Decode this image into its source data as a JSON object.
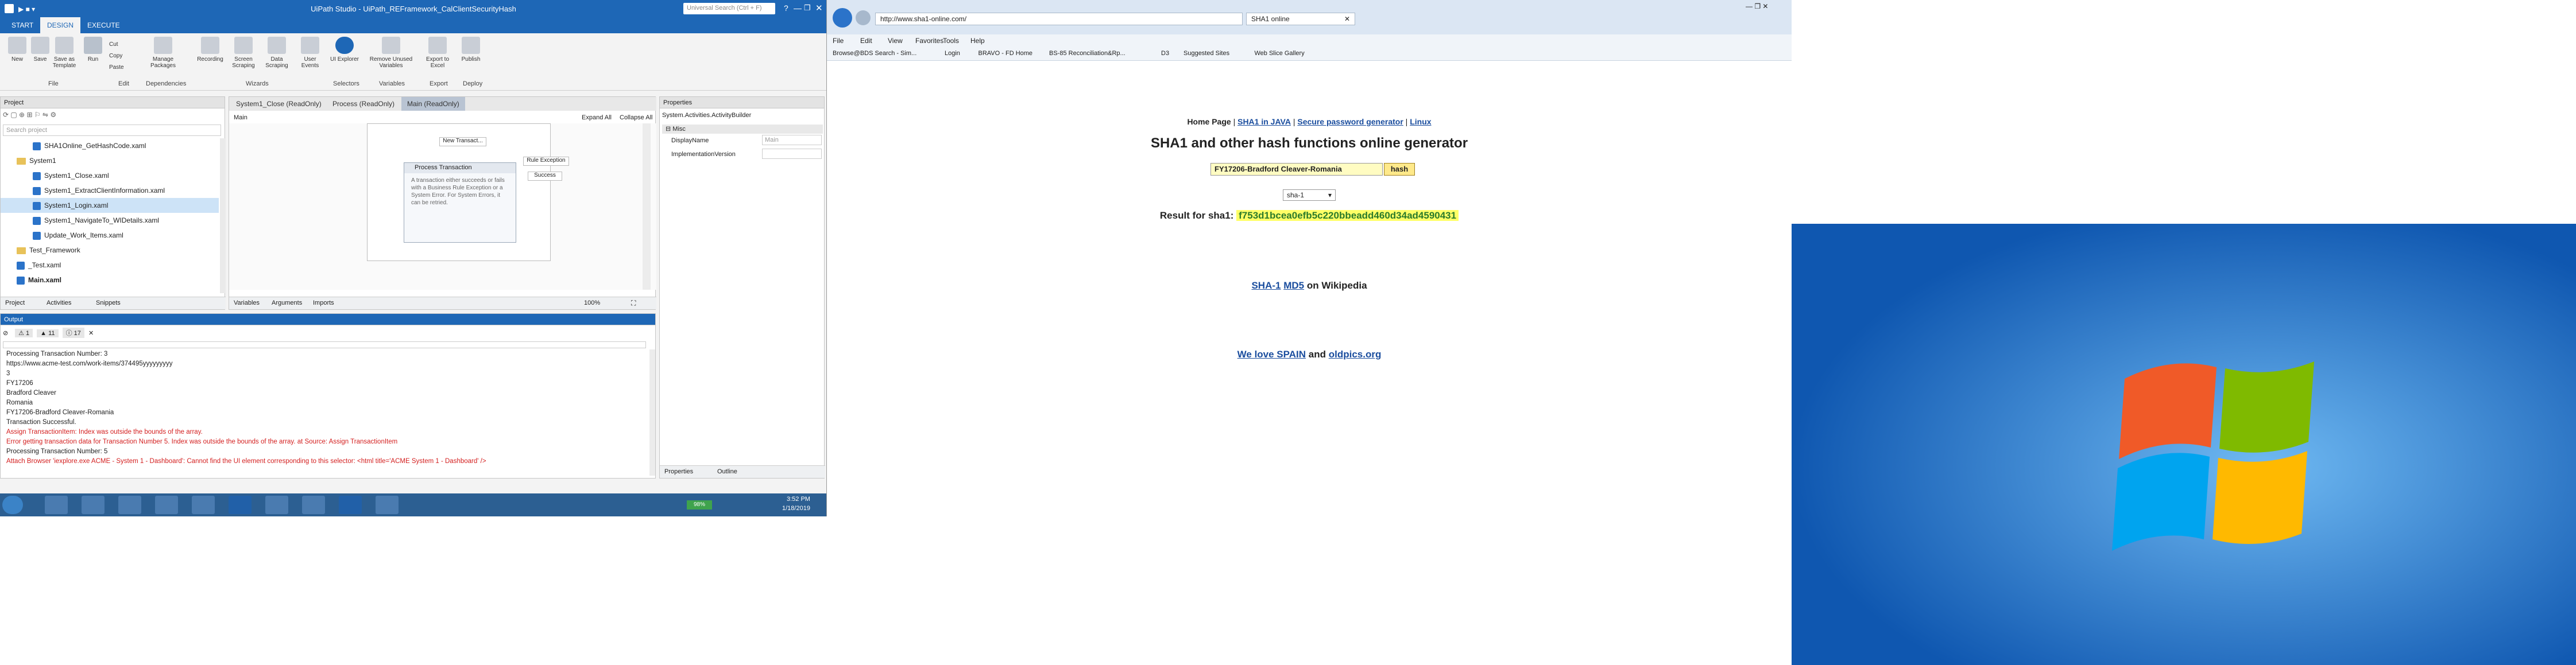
{
  "uipath": {
    "title": "UiPath Studio - UiPath_REFramework_CalClientSecurityHash",
    "search_placeholder": "Universal Search (Ctrl + F)",
    "menu": [
      "START",
      "DESIGN",
      "EXECUTE"
    ],
    "ribbon_buttons": [
      "New",
      "Save",
      "Save as Template",
      "Run",
      "Cut",
      "Copy",
      "Paste",
      "Manage Packages",
      "Recording",
      "Screen Scraping",
      "Data Scraping",
      "User Events",
      "UI Explorer",
      "Remove Unused Variables",
      "Export to Excel",
      "Publish"
    ],
    "ribbon_groups": [
      "File",
      "Edit",
      "Dependencies",
      "Wizards",
      "Selectors",
      "Variables",
      "Export",
      "Deploy"
    ],
    "project_panel": {
      "title": "Project",
      "search_placeholder": "Search project",
      "items": [
        {
          "label": "SHA1Online_GetHashCode.xaml",
          "type": "file",
          "indent": 2
        },
        {
          "label": "System1",
          "type": "folder",
          "indent": 1
        },
        {
          "label": "System1_Close.xaml",
          "type": "file",
          "indent": 2
        },
        {
          "label": "System1_ExtractClientInformation.xaml",
          "type": "file",
          "indent": 2
        },
        {
          "label": "System1_Login.xaml",
          "type": "file",
          "indent": 2,
          "selected": true
        },
        {
          "label": "System1_NavigateTo_WIDetails.xaml",
          "type": "file",
          "indent": 2
        },
        {
          "label": "Update_Work_Items.xaml",
          "type": "file",
          "indent": 2
        },
        {
          "label": "Test_Framework",
          "type": "folder",
          "indent": 1
        },
        {
          "label": "_Test.xaml",
          "type": "file",
          "indent": 1
        },
        {
          "label": "Main.xaml",
          "type": "file",
          "indent": 1,
          "bold": true
        }
      ],
      "bottom_tabs": [
        "Project",
        "Activities",
        "Snippets"
      ]
    },
    "designer": {
      "tabs": [
        "System1_Close (ReadOnly)",
        "Process (ReadOnly)",
        "Main (ReadOnly)"
      ],
      "breadcrumb": "Main",
      "expand_all": "Expand All",
      "collapse_all": "Collapse All",
      "node_new_transaction": "New Transact...",
      "node_process_transaction": "Process Transaction",
      "node_rule_exception": "Rule Exception",
      "node_success": "Success",
      "node_description": "A transaction either succeeds or fails with a Business Rule Exception or a System Error. For System Errors, it can be retried.",
      "bottom_tabs": [
        "Variables",
        "Arguments",
        "Imports"
      ],
      "zoom": "100%"
    },
    "properties_panel": {
      "title": "Properties",
      "subject": "System.Activities.ActivityBuilder",
      "category": "Misc",
      "rows": [
        {
          "name": "DisplayName",
          "value": "Main"
        },
        {
          "name": "ImplementationVersion",
          "value": ""
        }
      ],
      "bottom_tabs": [
        "Properties",
        "Outline"
      ]
    },
    "output_panel": {
      "title": "Output",
      "filter_counts": [
        "1",
        "11",
        "17"
      ],
      "lines": [
        {
          "text": "Processing Transaction Number: 3",
          "color": "#222222"
        },
        {
          "text": "https://www.acme-test.com/work-items/374495yyyyyyyyy",
          "color": "#222222"
        },
        {
          "text": "3",
          "color": "#222222"
        },
        {
          "text": "FY17206",
          "color": "#222222"
        },
        {
          "text": "Bradford Cleaver",
          "color": "#222222"
        },
        {
          "text": "Romania",
          "color": "#222222"
        },
        {
          "text": "FY17206-Bradford Cleaver-Romania",
          "color": "#222222"
        },
        {
          "text": "Transaction Successful.",
          "color": "#222222"
        },
        {
          "text": "Assign TransactionItem: Index was outside the bounds of the array.",
          "color": "#d42020"
        },
        {
          "text": "Error getting transaction data for Transaction Number 5. Index was outside the bounds of the array. at Source: Assign TransactionItem",
          "color": "#d42020"
        },
        {
          "text": "Processing Transaction Number: 5",
          "color": "#222222"
        },
        {
          "text": "Attach Browser 'iexplore.exe ACME - System 1 - Dashboard': Cannot find the UI element corresponding to this selector: <html title='ACME System 1 - Dashboard' />",
          "color": "#d42020"
        }
      ]
    }
  },
  "taskbar": {
    "time": "3:52 PM",
    "date": "1/18/2019",
    "battery": "98%"
  },
  "ie": {
    "url": "http://www.sha1-online.com/",
    "tab_title": "SHA1 online",
    "menu": [
      "File",
      "Edit",
      "View",
      "Favorites",
      "Tools",
      "Help"
    ],
    "favorites": [
      "Browse@BDS Search - Sim...",
      "Login",
      "BRAVO - FD Home",
      "BS-85 Reconciliation&Rp...",
      "D3",
      "Suggested Sites",
      "Web Slice Gallery"
    ],
    "page": {
      "nav": [
        "Home Page",
        "SHA1 in JAVA",
        "Secure password generator",
        "Linux"
      ],
      "heading": "SHA1 and other hash functions online generator",
      "input_value": "FY17206-Bradford Cleaver-Romania",
      "hash_button": "hash",
      "algorithm": "sha-1",
      "result_label": "Result for sha1:",
      "result_value": "f753d1bcea0efb5c220bbeadd460d34ad4590431",
      "wiki_link1": "SHA-1",
      "wiki_link2": "MD5",
      "wiki_suffix": "on Wikipedia",
      "footer_link1": "We love SPAIN",
      "footer_and": "and",
      "footer_link2": "oldpics.org"
    }
  }
}
